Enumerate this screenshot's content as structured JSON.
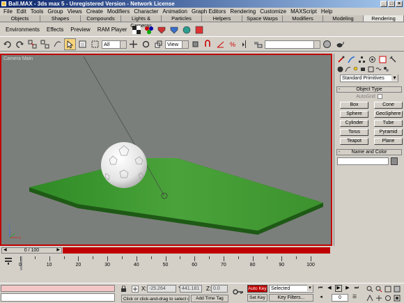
{
  "window": {
    "title": "Ball.MAX - 3ds max 5 - Unregistered Version - Network License",
    "controls": [
      "_",
      "□",
      "×"
    ]
  },
  "menu": [
    "File",
    "Edit",
    "Tools",
    "Group",
    "Views",
    "Create",
    "Modifiers",
    "Character",
    "Animation",
    "Graph Editors",
    "Rendering",
    "Customize",
    "MAXScript",
    "Help"
  ],
  "tabs": [
    "Objects",
    "Shapes",
    "Compounds",
    "Lights & Cameras",
    "Particles",
    "Helpers",
    "Space Warps",
    "Modifiers",
    "Modeling",
    "Rendering"
  ],
  "shelf": {
    "environments": "Environments",
    "effects": "Effects",
    "preview": "Preview",
    "ram_player": "RAM Player"
  },
  "toolbar": {
    "selection_filter": "All",
    "ref_coord": "View"
  },
  "viewport": {
    "label": "Camera Main"
  },
  "command_panel": {
    "category": "Standard Primitives",
    "object_type_title": "Object Type",
    "autogrid": "AutoGrid",
    "objects": [
      "Box",
      "Cone",
      "Sphere",
      "GeoSphere",
      "Cylinder",
      "Tube",
      "Torus",
      "Pyramid",
      "Teapot",
      "Plane"
    ],
    "name_color_title": "Name and Color"
  },
  "timeline": {
    "slider": "0 / 100",
    "ticks": [
      "0",
      "10",
      "20",
      "30",
      "40",
      "50",
      "60",
      "70",
      "80",
      "90",
      "100"
    ]
  },
  "status": {
    "x_label": "X:",
    "x_value": "-25.264",
    "y_label": "Y:",
    "y_value": "441.181",
    "z_label": "Z:",
    "z_value": "0.0",
    "prompt": "Click or click-and-drag to select obj",
    "time_tag": "Add Time Tag",
    "auto_key": "Auto Key",
    "set_key": "Set Key",
    "selection": "Selected",
    "key_filters": "Key Filters...",
    "frame": "0"
  },
  "colors": {
    "accent_red": "#c00000",
    "viewport_bg": "#7b7f7b",
    "plane_green": "#3e8f2a",
    "title_blue": "#0a246a"
  }
}
